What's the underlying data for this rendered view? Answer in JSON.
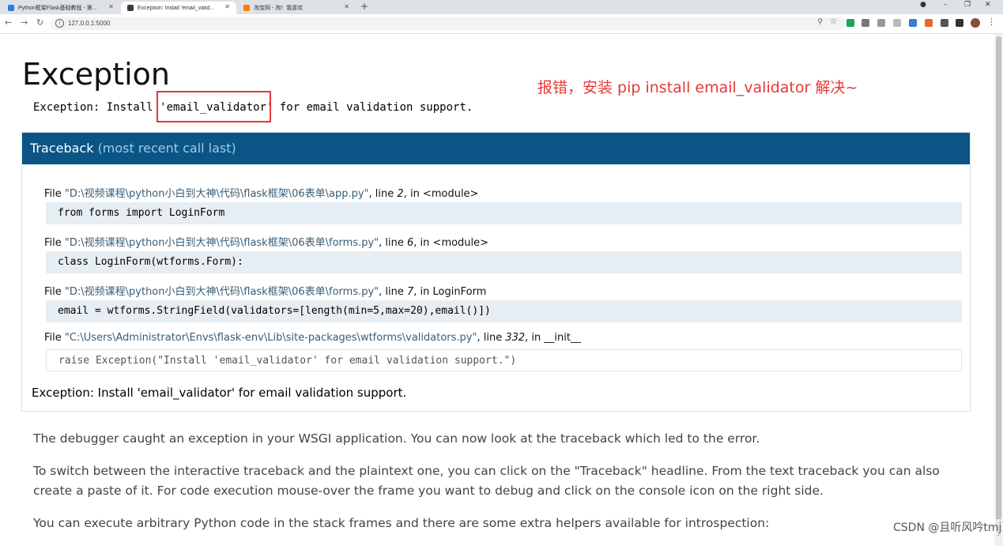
{
  "browser": {
    "tabs": [
      {
        "title": "Python框架Flask基础教程 - 第...",
        "color": "#2a7de1"
      },
      {
        "title": "Exception: Install 'email_valid...",
        "color": "#3a3a3a"
      },
      {
        "title": "淘宝网 - 淘！我喜欢",
        "color": "#ff7a00"
      }
    ],
    "url": "127.0.0.1:5000",
    "win_min": "–",
    "win_max": "❐",
    "win_close": "✕",
    "new_tab": "+"
  },
  "page": {
    "title": "Exception",
    "error_message": "Exception: Install 'email_validator' for email validation support.",
    "annotation": "报错，安装 pip install email_validator 解决~",
    "traceback": {
      "heading": "Traceback",
      "subheading": "(most recent call last)",
      "frames": [
        {
          "file": "\"D:\\视频课程\\python小白到大神\\代码\\flask框架\\06表单\\app.py\"",
          "line": "2",
          "func": "<module>",
          "code": "from forms import LoginForm"
        },
        {
          "file": "\"D:\\视频课程\\python小白到大神\\代码\\flask框架\\06表单\\forms.py\"",
          "line": "6",
          "func": "<module>",
          "code": "class LoginForm(wtforms.Form):"
        },
        {
          "file": "\"D:\\视频课程\\python小白到大神\\代码\\flask框架\\06表单\\forms.py\"",
          "line": "7",
          "func": "LoginForm",
          "code": "email = wtforms.StringField(validators=[length(min=5,max=20),email()])"
        },
        {
          "file": "\"C:\\Users\\Administrator\\Envs\\flask-env\\Lib\\site-packages\\wtforms\\validators.py\"",
          "line": "332",
          "func": "__init__",
          "code": "raise Exception(\"Install 'email_validator' for email validation support.\")"
        }
      ],
      "final_exception": "Exception: Install 'email_validator' for email validation support."
    },
    "paragraphs": [
      "The debugger caught an exception in your WSGI application. You can now look at the traceback which led to the error.",
      "To switch between the interactive traceback and the plaintext one, you can click on the \"Traceback\" headline. From the text traceback you can also create a paste of it. For code execution mouse-over the frame you want to debug and click on the console icon on the right side.",
      "You can execute arbitrary Python code in the stack frames and there are some extra helpers available for introspection:"
    ],
    "watermark": "CSDN @且听风吟tmj"
  }
}
